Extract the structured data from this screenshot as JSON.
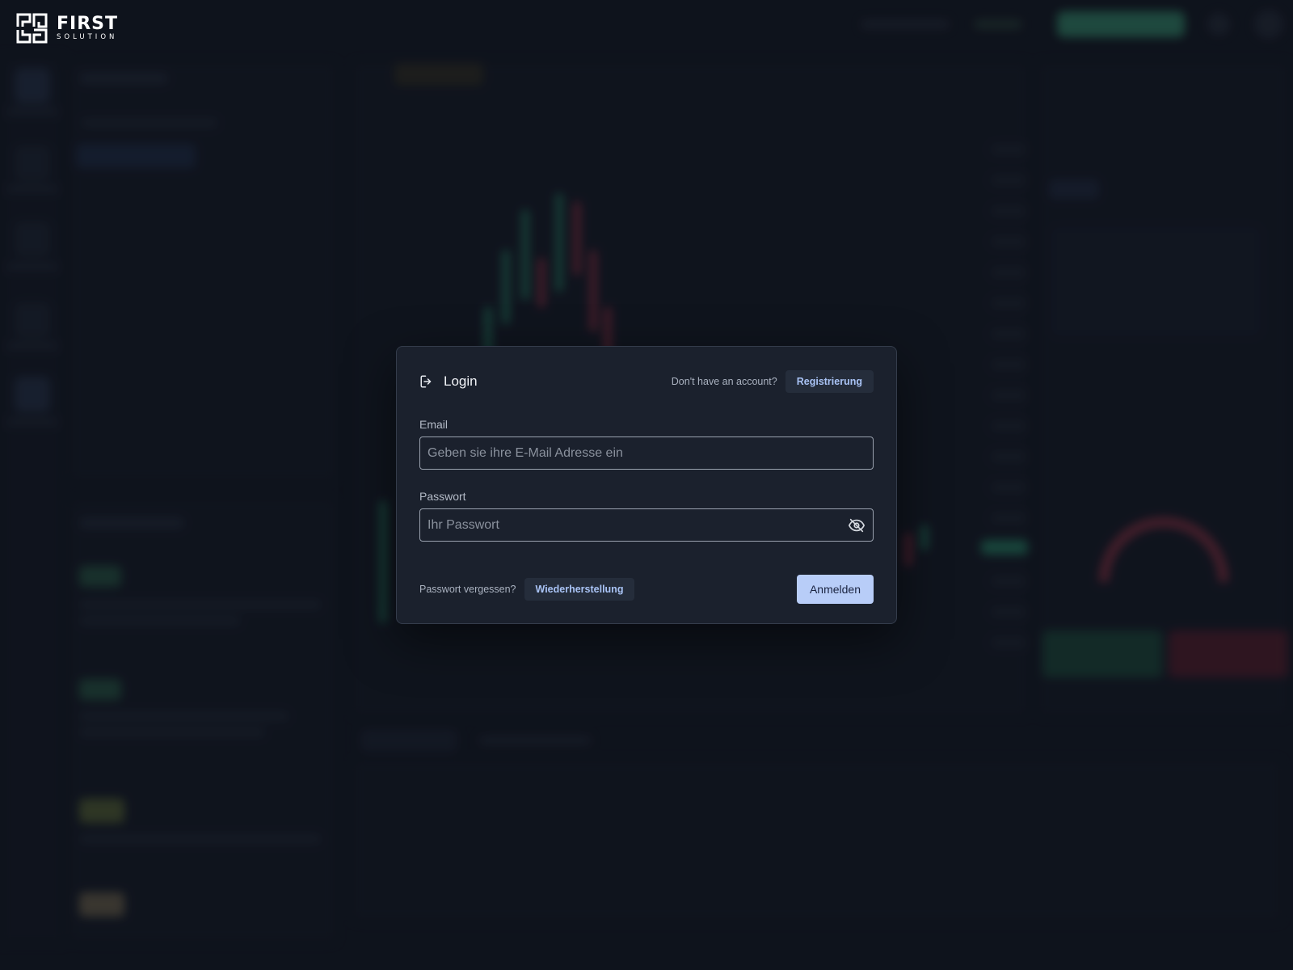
{
  "brand": {
    "name": "FIRST",
    "tagline": "SOLUTION"
  },
  "login_modal": {
    "title": "Login",
    "no_account_text": "Don't have an account?",
    "register_label": "Registrierung",
    "email": {
      "label": "Email",
      "placeholder": "Geben sie ihre E-Mail Adresse ein",
      "value": ""
    },
    "password": {
      "label": "Passwort",
      "placeholder": "Ihr Passwort",
      "value": ""
    },
    "forgot_text": "Passwort vergessen?",
    "recover_label": "Wiederherstellung",
    "submit_label": "Anmelden"
  },
  "icons": {
    "login": "login-icon",
    "password_visibility": "eye-off-icon"
  },
  "colors": {
    "background": "#121722",
    "modal_bg": "#1b212d",
    "primary_button": "#b8cdf8",
    "link_chip_bg": "#252d3b",
    "link_text": "#a9c3f5",
    "accent_green": "#3fae82",
    "accent_red": "#b33a4e"
  }
}
